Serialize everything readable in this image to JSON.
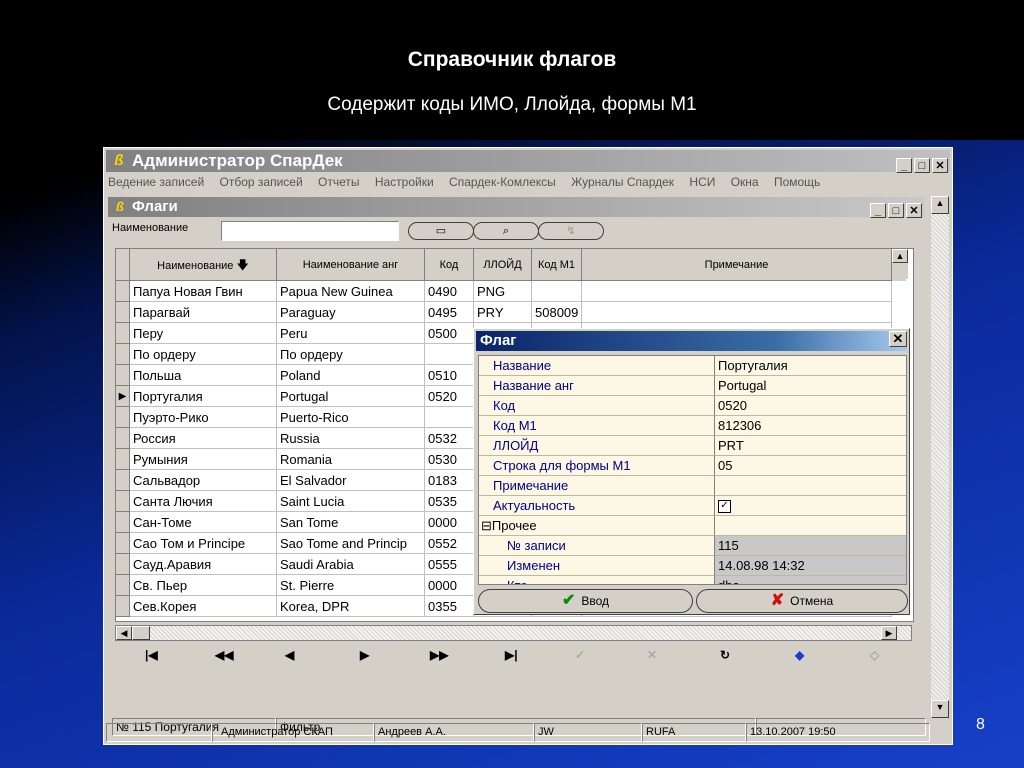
{
  "slide": {
    "title": "Справочник флагов",
    "subtitle": "Содержит коды ИМО, Ллойда, формы М1",
    "page_number": "8"
  },
  "app": {
    "title": "Администратор СпарДек",
    "menu": [
      "Ведение записей",
      "Отбор записей",
      "Отчеты",
      "Настройки",
      "Спардек-Комлексы",
      "Журналы Спардек",
      "НСИ",
      "Окна",
      "Помощь"
    ],
    "status": [
      "",
      "Администратор СКАП",
      "Андреев А.А.",
      "JW",
      "RUFA",
      "13.10.2007 19:50"
    ]
  },
  "flags_window": {
    "title": "Флаги",
    "filter_label": "Наименование",
    "columns": [
      "Наименование",
      "Наименование анг",
      "Код",
      "ЛЛОЙД",
      "Код М1",
      "Примечание"
    ],
    "rows": [
      [
        "Папуа Новая Гвин",
        "Papua New Guinea",
        "0490",
        "PNG",
        "",
        ""
      ],
      [
        "Парагвай",
        "Paraguay",
        "0495",
        "PRY",
        "508009",
        ""
      ],
      [
        "Перу",
        "Peru",
        "0500",
        "",
        "",
        ""
      ],
      [
        "По ордеру",
        "По ордеру",
        "",
        "",
        "",
        ""
      ],
      [
        "Польша",
        "Poland",
        "0510",
        "",
        "",
        ""
      ],
      [
        "Португалия",
        "Portugal",
        "0520",
        "",
        "",
        ""
      ],
      [
        "Пуэрто-Рико",
        "Puerto-Rico",
        "",
        "",
        "",
        ""
      ],
      [
        "Россия",
        "Russia",
        "0532",
        "",
        "",
        ""
      ],
      [
        "Румыния",
        "Romania",
        "0530",
        "",
        "",
        ""
      ],
      [
        "Сальвадор",
        "El Salvador",
        "0183",
        "",
        "",
        ""
      ],
      [
        "Санта Лючия",
        "Saint Lucia",
        "0535",
        "",
        "",
        ""
      ],
      [
        "Сан-Томе",
        "San Tome",
        "0000",
        "",
        "",
        ""
      ],
      [
        "Сао Том и Principe",
        "Sao Tome and Princip",
        "0552",
        "",
        "",
        ""
      ],
      [
        "Сауд.Аравия",
        "Saudi Arabia",
        "0555",
        "",
        "",
        ""
      ],
      [
        "Св. Пьер",
        "St. Pierre",
        "0000",
        "",
        "",
        ""
      ],
      [
        "Сев.Корея",
        "Korea, DPR",
        "0355",
        "",
        "",
        ""
      ]
    ],
    "selected_row": 5,
    "status_left": "№ 115 Португалия",
    "status_filter": "Фильтр"
  },
  "dialog": {
    "title": "Флаг",
    "props": [
      {
        "k": "Название",
        "v": "Португалия"
      },
      {
        "k": "Название анг",
        "v": "Portugal"
      },
      {
        "k": "Код",
        "v": "0520"
      },
      {
        "k": "Код М1",
        "v": "812306"
      },
      {
        "k": "ЛЛОЙД",
        "v": "PRT"
      },
      {
        "k": "Строка для формы М1",
        "v": "05"
      },
      {
        "k": "Примечание",
        "v": ""
      },
      {
        "k": "Актуальность",
        "v": ""
      },
      {
        "k": "⊟Прочее",
        "v": ""
      },
      {
        "k": "№ записи",
        "v": "115"
      },
      {
        "k": "Изменен",
        "v": "14.08.98 14:32"
      },
      {
        "k": "Кто",
        "v": "dba"
      }
    ],
    "ok_label": "Ввод",
    "cancel_label": "Отмена"
  }
}
